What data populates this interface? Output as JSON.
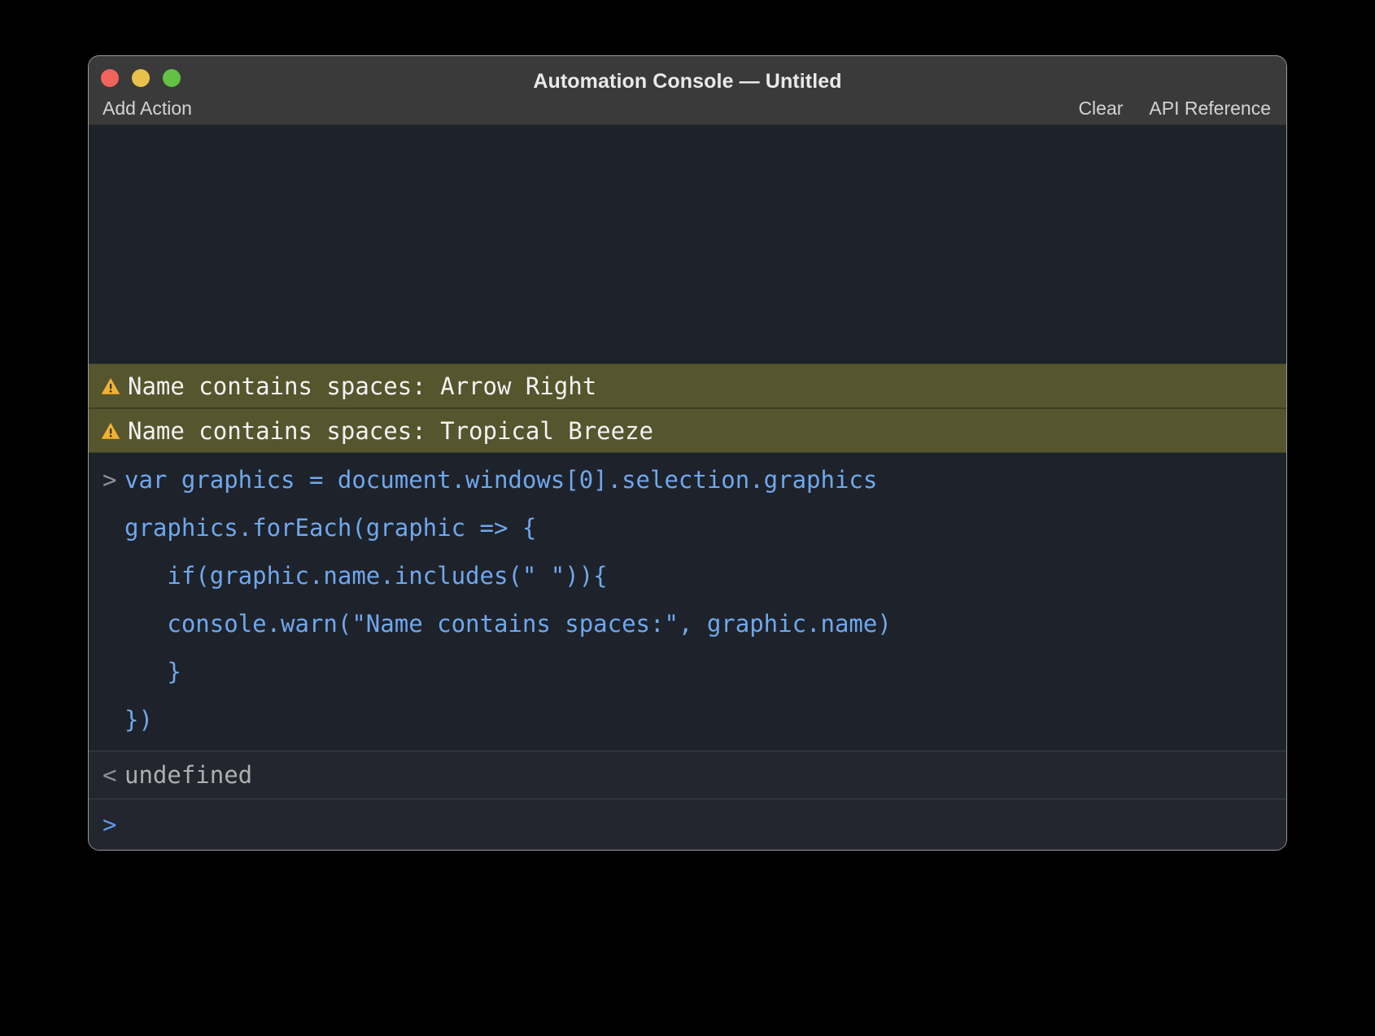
{
  "window": {
    "title": "Automation Console — Untitled",
    "traffic_lights": [
      {
        "name": "close",
        "color": "#F0645C"
      },
      {
        "name": "minimize",
        "color": "#E7C149"
      },
      {
        "name": "zoom",
        "color": "#62C244"
      }
    ]
  },
  "toolbar": {
    "left": [
      {
        "name": "add-action",
        "label": "Add Action"
      }
    ],
    "right": [
      {
        "name": "clear",
        "label": "Clear"
      },
      {
        "name": "api-reference",
        "label": "API Reference"
      }
    ]
  },
  "console": {
    "warnings": [
      {
        "icon": "warning-triangle-icon",
        "text": "Name contains spaces: Arrow Right"
      },
      {
        "icon": "warning-triangle-icon",
        "text": "Name contains spaces: Tropical Breeze"
      }
    ],
    "input_block": {
      "prompt_symbol": ">",
      "lines": [
        "var graphics = document.windows[0].selection.graphics",
        "graphics.forEach(graphic => {",
        "   if(graphic.name.includes(\" \")){",
        "   console.warn(\"Name contains spaces:\", graphic.name)",
        "   }",
        "})"
      ]
    },
    "result": {
      "prompt_symbol": "<",
      "value": "undefined"
    },
    "prompt": {
      "symbol": ">",
      "value": "",
      "placeholder": ""
    },
    "colors": {
      "background": "#1E222B",
      "warning_background": "#55552E",
      "code_text": "#6FA8EC",
      "result_text": "#AFAFAF",
      "warning_icon": "#F2B134"
    }
  }
}
